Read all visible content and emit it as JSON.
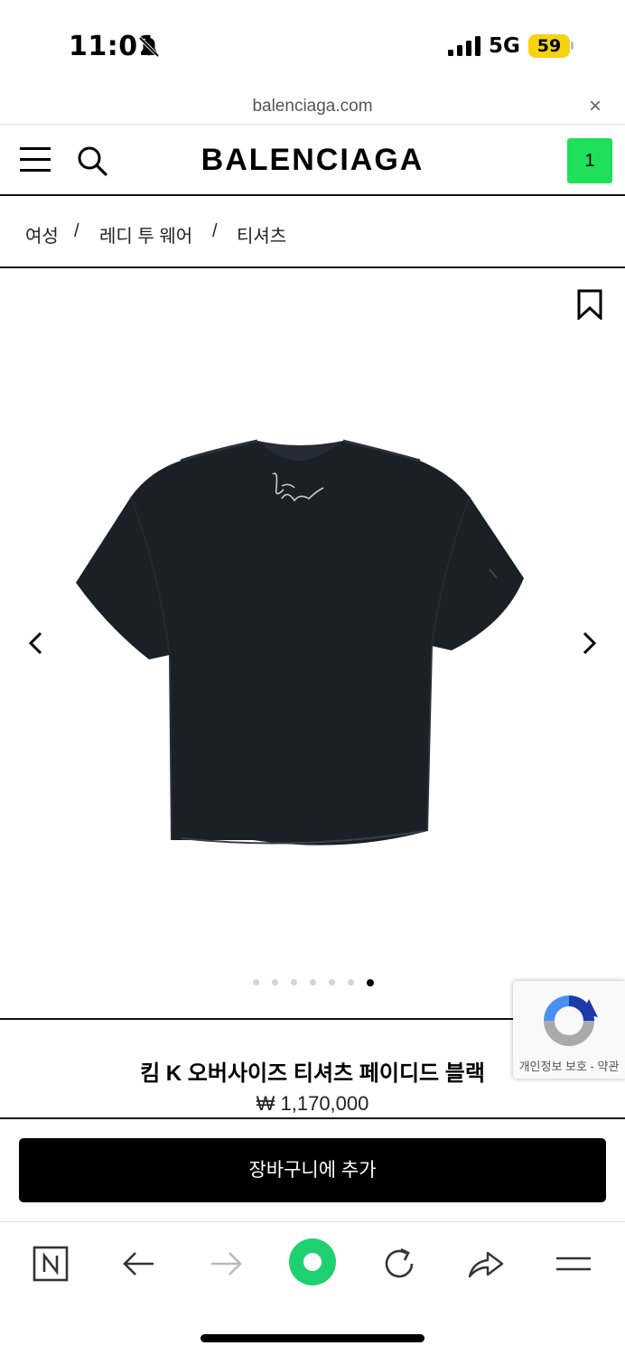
{
  "status_bar": {
    "time": "11:01",
    "network": "5G",
    "battery": "59"
  },
  "url_bar": {
    "url": "balenciaga.com",
    "close": "×"
  },
  "header": {
    "logo": "BALENCIAGA",
    "cart_count": "1"
  },
  "breadcrumb": {
    "items": [
      "여성",
      "레디 투 웨어",
      "티셔츠"
    ],
    "separator": "/"
  },
  "gallery": {
    "image_count": 7,
    "active_index": 6
  },
  "product": {
    "name": "킴 K 오버사이즈 티셔츠 페이디드 블랙",
    "price": "₩ 1,170,000"
  },
  "recaptcha": {
    "text": "개인정보 보호 - 약관"
  },
  "actions": {
    "add_to_cart": "장바구니에 추가"
  },
  "colors": {
    "cart_badge": "#1fe05a",
    "battery": "#f5d312",
    "toolbar_accent": "#1fd070"
  }
}
